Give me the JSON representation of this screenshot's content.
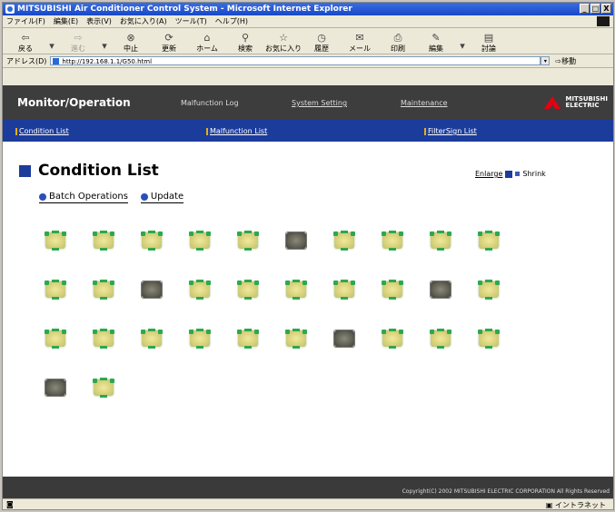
{
  "window": {
    "title": "MITSUBISHI Air Conditioner Control System - Microsoft Internet Explorer",
    "min": "_",
    "max": "□",
    "close": "X"
  },
  "menu": [
    "ファイル(F)",
    "編集(E)",
    "表示(V)",
    "お気に入り(A)",
    "ツール(T)",
    "ヘルプ(H)"
  ],
  "toolbar": {
    "back": "戻る",
    "forward": "進む",
    "stop": "中止",
    "refresh": "更新",
    "home": "ホーム",
    "search": "検索",
    "favorites": "お気に入り",
    "history": "履歴",
    "mail": "メール",
    "print": "印刷",
    "edit": "編集",
    "discuss": "討論"
  },
  "address": {
    "label": "アドレス(D)",
    "url": "http://192.168.1.1/G50.html",
    "go": "移動"
  },
  "header": {
    "title": "Monitor/Operation",
    "links": [
      "Malfunction Log",
      "System Setting",
      "Maintenance"
    ],
    "logo_line1": "MITSUBISHI",
    "logo_line2": "ELECTRIC"
  },
  "subnav": [
    "Condition List",
    "Malfunction List",
    "FilterSign List"
  ],
  "page": {
    "title": "Condition List",
    "enlarge": "Enlarge",
    "shrink": "Shrink"
  },
  "actions": [
    "Batch Operations",
    "Update"
  ],
  "units": [
    {
      "row": 0,
      "col": 0,
      "state": "on"
    },
    {
      "row": 0,
      "col": 1,
      "state": "on"
    },
    {
      "row": 0,
      "col": 2,
      "state": "on"
    },
    {
      "row": 0,
      "col": 3,
      "state": "on"
    },
    {
      "row": 0,
      "col": 4,
      "state": "on"
    },
    {
      "row": 0,
      "col": 5,
      "state": "off"
    },
    {
      "row": 0,
      "col": 6,
      "state": "on"
    },
    {
      "row": 0,
      "col": 7,
      "state": "on"
    },
    {
      "row": 0,
      "col": 8,
      "state": "on"
    },
    {
      "row": 0,
      "col": 9,
      "state": "on"
    },
    {
      "row": 1,
      "col": 0,
      "state": "on"
    },
    {
      "row": 1,
      "col": 1,
      "state": "on"
    },
    {
      "row": 1,
      "col": 2,
      "state": "off"
    },
    {
      "row": 1,
      "col": 3,
      "state": "on"
    },
    {
      "row": 1,
      "col": 4,
      "state": "on"
    },
    {
      "row": 1,
      "col": 5,
      "state": "on"
    },
    {
      "row": 1,
      "col": 6,
      "state": "on"
    },
    {
      "row": 1,
      "col": 7,
      "state": "on"
    },
    {
      "row": 1,
      "col": 8,
      "state": "off"
    },
    {
      "row": 1,
      "col": 9,
      "state": "on"
    },
    {
      "row": 2,
      "col": 0,
      "state": "on"
    },
    {
      "row": 2,
      "col": 1,
      "state": "on"
    },
    {
      "row": 2,
      "col": 2,
      "state": "on"
    },
    {
      "row": 2,
      "col": 3,
      "state": "on"
    },
    {
      "row": 2,
      "col": 4,
      "state": "on"
    },
    {
      "row": 2,
      "col": 5,
      "state": "on"
    },
    {
      "row": 2,
      "col": 6,
      "state": "off"
    },
    {
      "row": 2,
      "col": 7,
      "state": "on"
    },
    {
      "row": 2,
      "col": 8,
      "state": "on"
    },
    {
      "row": 2,
      "col": 9,
      "state": "on"
    },
    {
      "row": 3,
      "col": 0,
      "state": "off"
    },
    {
      "row": 3,
      "col": 1,
      "state": "on"
    }
  ],
  "footer": {
    "copyright": "Copyright(C) 2002 MITSUBISHI ELECTRIC CORPORATION All Rights Reserved"
  },
  "status": {
    "zone": "イントラネット"
  },
  "colors": {
    "header_bg": "#3d3d3d",
    "subnav_bg": "#1c3c9c",
    "unit_on": "#d9d27a",
    "unit_on_accent": "#2da84f",
    "unit_off": "#5e5e52"
  }
}
